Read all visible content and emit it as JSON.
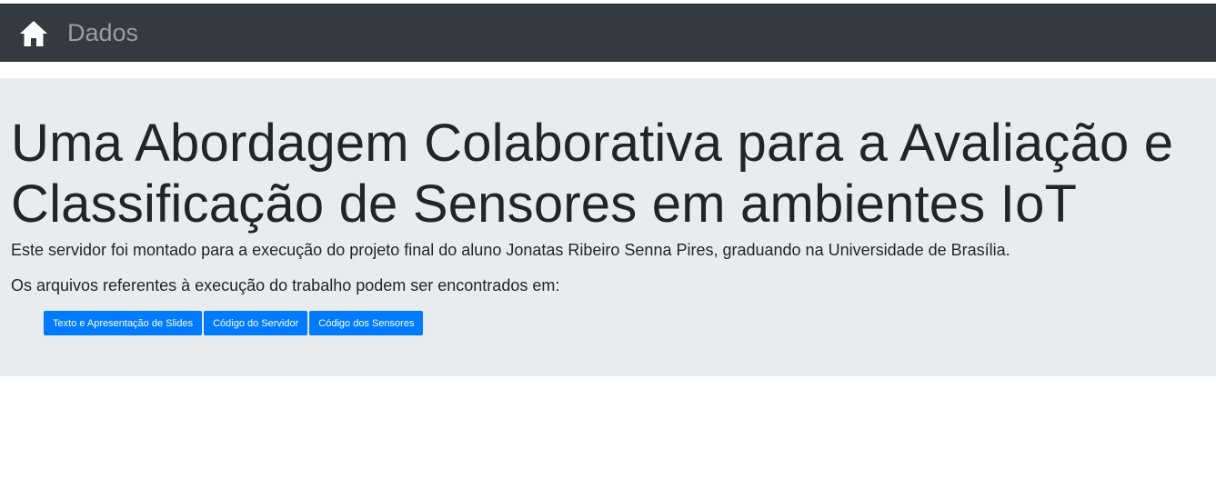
{
  "navbar": {
    "home_icon": "home-icon",
    "brand": "Dados"
  },
  "jumbotron": {
    "title": "Uma Abordagem Colaborativa para a Avaliação e Classificação de Sensores em ambientes IoT",
    "lead_1": "Este servidor foi montado para a execução do projeto final do aluno Jonatas Ribeiro Senna Pires, graduando na Universidade de Brasília.",
    "lead_2": "Os arquivos referentes à execução do trabalho podem ser encontrados em:",
    "buttons": [
      {
        "label": "Texto e Apresentação de Slides"
      },
      {
        "label": "Código do Servidor"
      },
      {
        "label": "Código dos Sensores"
      }
    ]
  },
  "colors": {
    "navbar_bg": "#343a40",
    "jumbotron_bg": "#e9ecef",
    "button_primary": "#007bff"
  }
}
